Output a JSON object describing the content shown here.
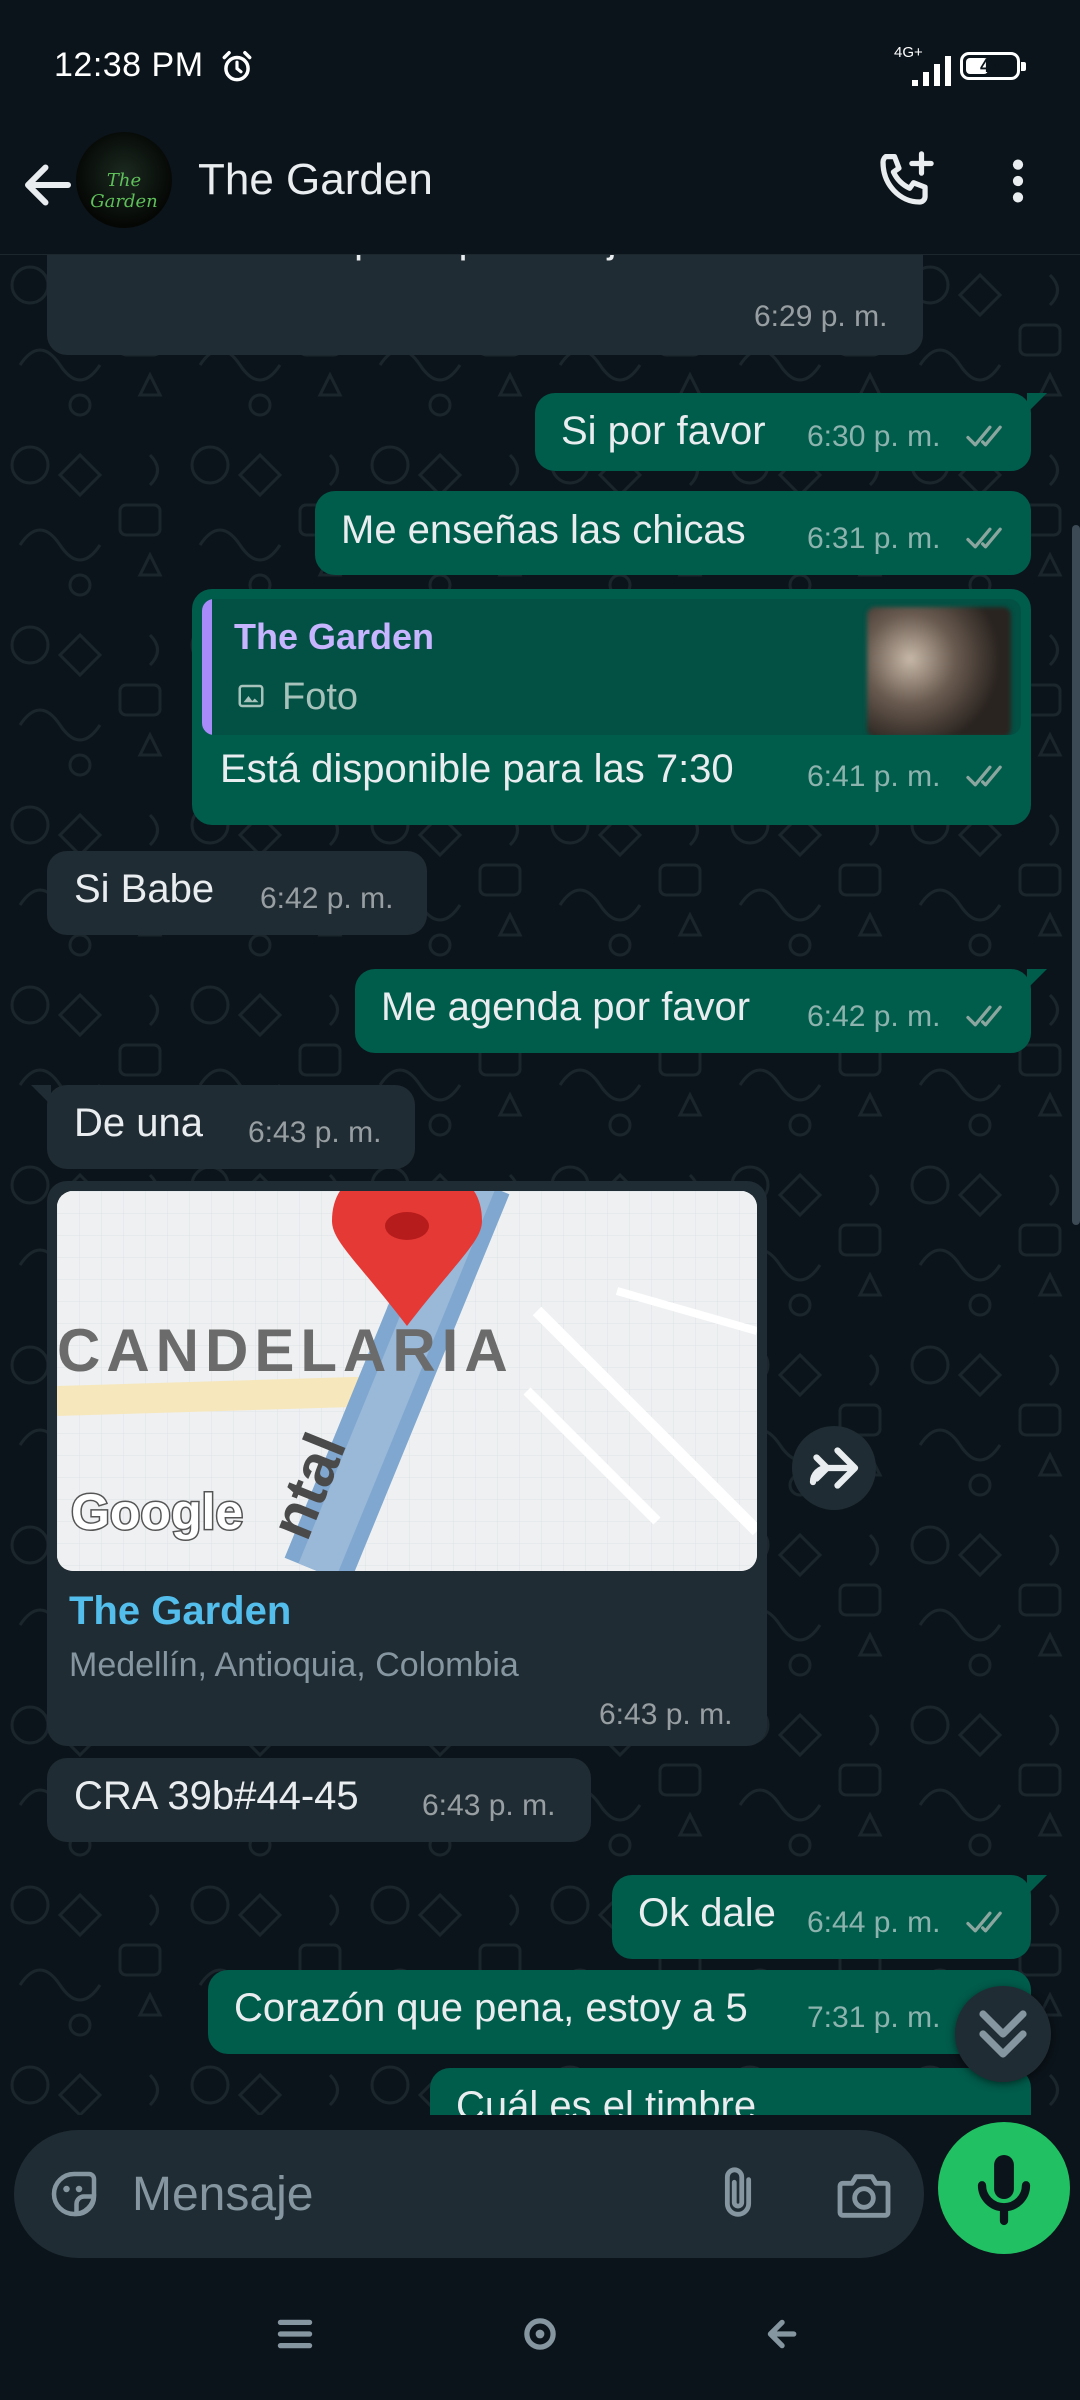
{
  "status_bar": {
    "time": "12:38 PM",
    "network": "4G+",
    "battery": "42"
  },
  "header": {
    "contact_name": "The Garden",
    "avatar_text": "The Garden"
  },
  "messages": [
    {
      "text": "dos mamacitas para que escojas .",
      "time": "6:29 p. m."
    },
    {
      "text": "Si por favor",
      "time": "6:30 p. m."
    },
    {
      "text": "Me enseñas las chicas",
      "time": "6:31 p. m."
    },
    {
      "quote_name": "The Garden",
      "quote_type": "Foto",
      "text": "Está disponible para las 7:30",
      "time": "6:41 p. m."
    },
    {
      "text": "Si Babe",
      "time": "6:42 p. m."
    },
    {
      "text": "Me agenda por favor",
      "time": "6:42 p. m."
    },
    {
      "text": "De una",
      "time": "6:43 p. m."
    },
    {
      "map_label": "CANDELARIA",
      "map_road": "ntal",
      "map_brand": "Google",
      "loc_title": "The Garden",
      "loc_sub": "Medellín, Antioquia, Colombia",
      "time": "6:43 p. m."
    },
    {
      "text": "CRA 39b#44-45",
      "time": "6:43 p. m."
    },
    {
      "text": "Ok dale",
      "time": "6:44 p. m."
    },
    {
      "text": "Corazón que pena, estoy a 5",
      "time": "7:31 p. m."
    },
    {
      "text": "Cuál es el timbre"
    }
  ],
  "input": {
    "placeholder": "Mensaje"
  },
  "colors": {
    "incoming": "#202c33",
    "outgoing": "#005c4b",
    "accent": "#21c063",
    "background": "#0b141a",
    "read_ticks": "#8ba69f"
  },
  "icons": [
    "alarm-icon",
    "signal-icon",
    "battery-icon",
    "back-arrow-icon",
    "add-call-icon",
    "more-vert-icon",
    "double-check-icon",
    "photo-icon",
    "map-pin-icon",
    "forward-icon",
    "chevron-double-down-icon",
    "sticker-icon",
    "paperclip-icon",
    "camera-icon",
    "mic-icon",
    "nav-menu-icon",
    "nav-home-icon",
    "nav-back-icon"
  ]
}
